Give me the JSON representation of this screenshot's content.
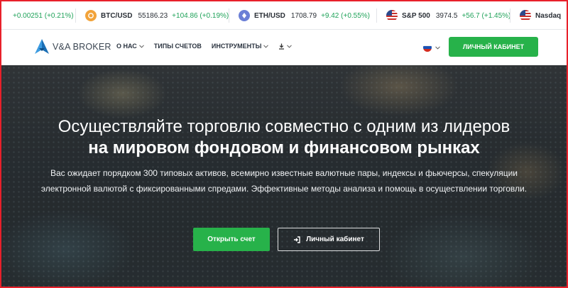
{
  "ticker": [
    {
      "symbol": "",
      "price": "",
      "change": "+0.00251 (+0.21%)",
      "icon": "currency-icon",
      "color": "#e9a23b"
    },
    {
      "symbol": "BTC/USD",
      "price": "55186.23",
      "change": "+104.86 (+0.19%)",
      "icon": "bitcoin-icon",
      "color": "#f2a33a"
    },
    {
      "symbol": "ETH/USD",
      "price": "1708.79",
      "change": "+9.42 (+0.55%)",
      "icon": "ethereum-icon",
      "color": "#6b7fd6"
    },
    {
      "symbol": "S&P 500",
      "price": "3974.5",
      "change": "+56.7 (+1.45%)",
      "icon": "us-flag-icon",
      "color": "#c9302c"
    },
    {
      "symbol": "Nasdaq",
      "price": "",
      "change": "",
      "icon": "us-flag-icon",
      "color": "#c9302c"
    }
  ],
  "header": {
    "brand": "V&A BROKER",
    "nav": [
      {
        "label": "О НАС",
        "dropdown": true
      },
      {
        "label": "ТИПЫ СЧЕТОВ",
        "dropdown": false
      },
      {
        "label": "ИНСТРУМЕНТЫ",
        "dropdown": true
      },
      {
        "label": "",
        "dropdown": true,
        "icon": "download-icon"
      }
    ],
    "language_icon": "russian-flag-icon",
    "cabinet_label": "ЛИЧНЫЙ КАБИНЕТ"
  },
  "hero": {
    "title_line1": "Осуществляйте торговлю совместно с одним из лидеров",
    "title_line2": "на мировом фондовом и финансовом рынках",
    "subtitle": "Вас ожидает порядком 300 типовых активов, всемирно известные валютные пары, индексы и фьючерсы, спекуляции электронной валютой с фиксированными спредами. Эффективные методы анализа и помощь в осуществлении торговли.",
    "open_account_label": "Открыть счет",
    "cabinet_label": "Личный кабинет"
  },
  "colors": {
    "accent_green": "#27b24a",
    "positive_change": "#20a35a",
    "frame_red": "#e8202a"
  }
}
